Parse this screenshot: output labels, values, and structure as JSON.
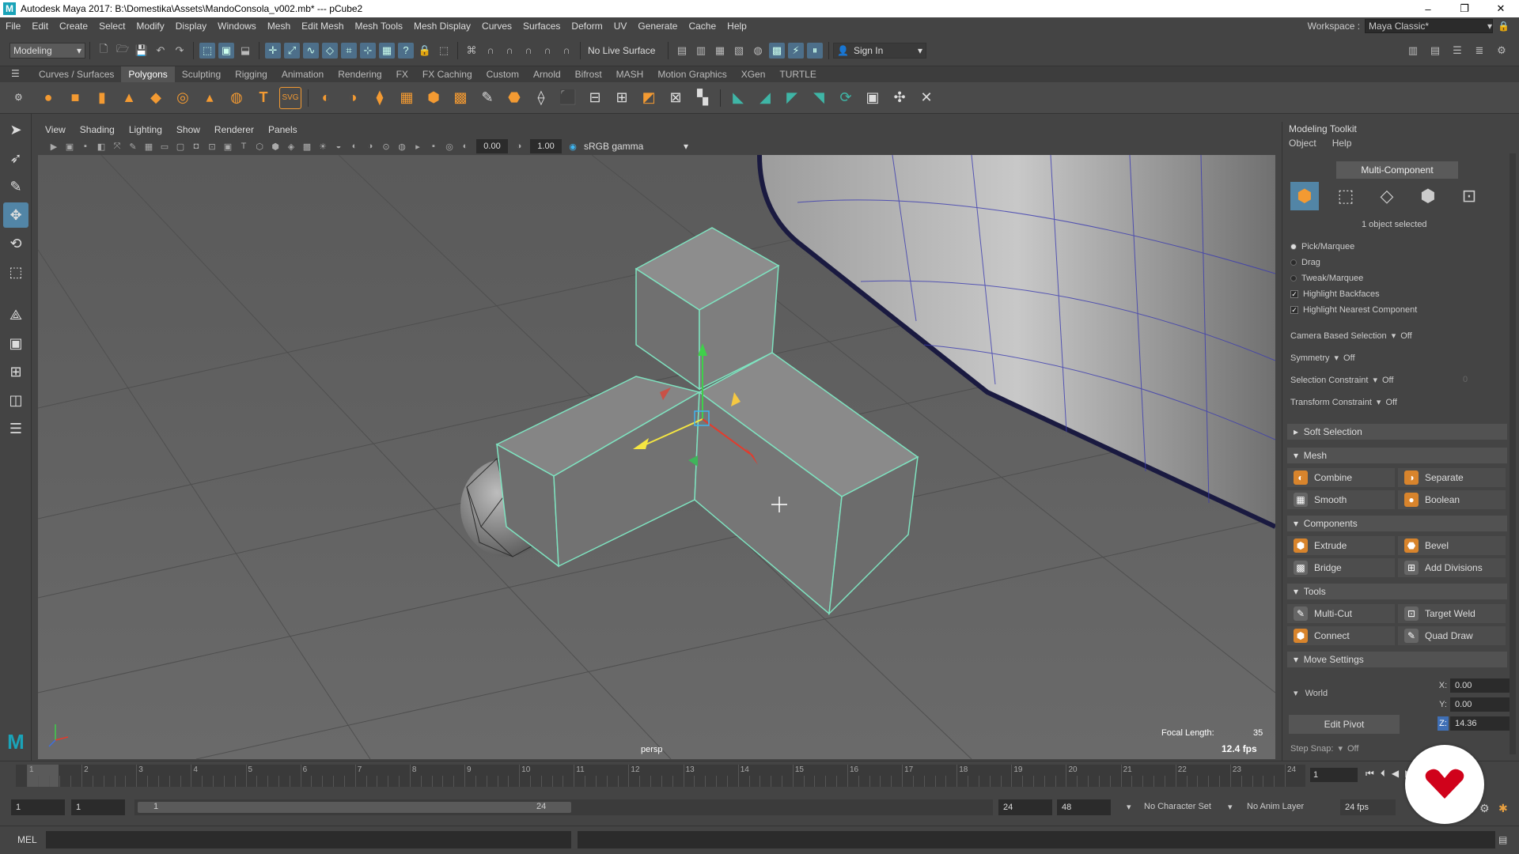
{
  "window": {
    "title": "Autodesk Maya 2017: B:\\Domestika\\Assets\\MandoConsola_v002.mb*  ---  pCube2",
    "minimize": "–",
    "maximize": "❐",
    "close": "✕"
  },
  "menubar": {
    "items": [
      "File",
      "Edit",
      "Create",
      "Select",
      "Modify",
      "Display",
      "Windows",
      "Mesh",
      "Edit Mesh",
      "Mesh Tools",
      "Mesh Display",
      "Curves",
      "Surfaces",
      "Deform",
      "UV",
      "Generate",
      "Cache",
      "Help"
    ],
    "workspace_label": "Workspace :",
    "workspace_value": "Maya Classic*"
  },
  "statusline": {
    "mode": "Modeling",
    "live_surface": "No Live Surface",
    "sign_in": "Sign In"
  },
  "shelf": {
    "tabs": [
      "Curves / Surfaces",
      "Polygons",
      "Sculpting",
      "Rigging",
      "Animation",
      "Rendering",
      "FX",
      "FX Caching",
      "Custom",
      "Arnold",
      "Bifrost",
      "MASH",
      "Motion Graphics",
      "XGen",
      "TURTLE"
    ],
    "active_tab": "Polygons"
  },
  "viewport": {
    "menus": [
      "View",
      "Shading",
      "Lighting",
      "Show",
      "Renderer",
      "Panels"
    ],
    "exposure": "0.00",
    "gamma": "1.00",
    "color_space": "sRGB gamma",
    "camera_label": "persp",
    "focal_length_label": "Focal Length:",
    "focal_length_value": "35",
    "fps": "12.4 fps"
  },
  "toolkit": {
    "title": "Modeling Toolkit",
    "menu": [
      "Object",
      "Help"
    ],
    "multi_component": "Multi-Component",
    "selection_status": "1 object selected",
    "pick_marquee": "Pick/Marquee",
    "drag": "Drag",
    "tweak_marquee": "Tweak/Marquee",
    "highlight_backfaces": "Highlight Backfaces",
    "highlight_nearest": "Highlight Nearest Component",
    "camera_based_selection": "Camera Based Selection",
    "camera_based_value": "Off",
    "symmetry": "Symmetry",
    "symmetry_value": "Off",
    "selection_constraint": "Selection Constraint",
    "selection_constraint_value": "Off",
    "selection_constraint_num": "0",
    "transform_constraint": "Transform Constraint",
    "transform_constraint_value": "Off",
    "soft_selection": "Soft Selection",
    "mesh_section": "Mesh",
    "combine": "Combine",
    "separate": "Separate",
    "smooth": "Smooth",
    "boolean": "Boolean",
    "components_section": "Components",
    "extrude": "Extrude",
    "bevel": "Bevel",
    "bridge": "Bridge",
    "add_divisions": "Add Divisions",
    "tools_section": "Tools",
    "multi_cut": "Multi-Cut",
    "target_weld": "Target Weld",
    "connect": "Connect",
    "quad_draw": "Quad Draw",
    "move_settings": "Move Settings",
    "world": "World",
    "edit_pivot": "Edit Pivot",
    "x_label": "X:",
    "y_label": "Y:",
    "z_label": "Z:",
    "x": "0.00",
    "y": "0.00",
    "z": "14.36",
    "step_snap": "Step Snap:",
    "step_snap_value": "Off"
  },
  "timeline": {
    "tick_labels": [
      "1",
      "2",
      "3",
      "4",
      "5",
      "6",
      "7",
      "8",
      "9",
      "10",
      "11",
      "12",
      "13",
      "14",
      "15",
      "16",
      "17",
      "18",
      "19",
      "20",
      "21",
      "22",
      "23",
      "24"
    ],
    "current_frame_label": "1",
    "current_frame": "1"
  },
  "range": {
    "start": "1",
    "playback_start": "1",
    "slider_start": "1",
    "slider_end": "24",
    "playback_end": "24",
    "end": "48",
    "character_set": "No Character Set",
    "anim_layer": "No Anim Layer",
    "fps": "24 fps"
  },
  "command": {
    "label": "MEL"
  },
  "colors": {
    "selection_highlight": "#7fe3c0",
    "active_blue": "#5285a6",
    "overlay_red": "#d0021b"
  }
}
